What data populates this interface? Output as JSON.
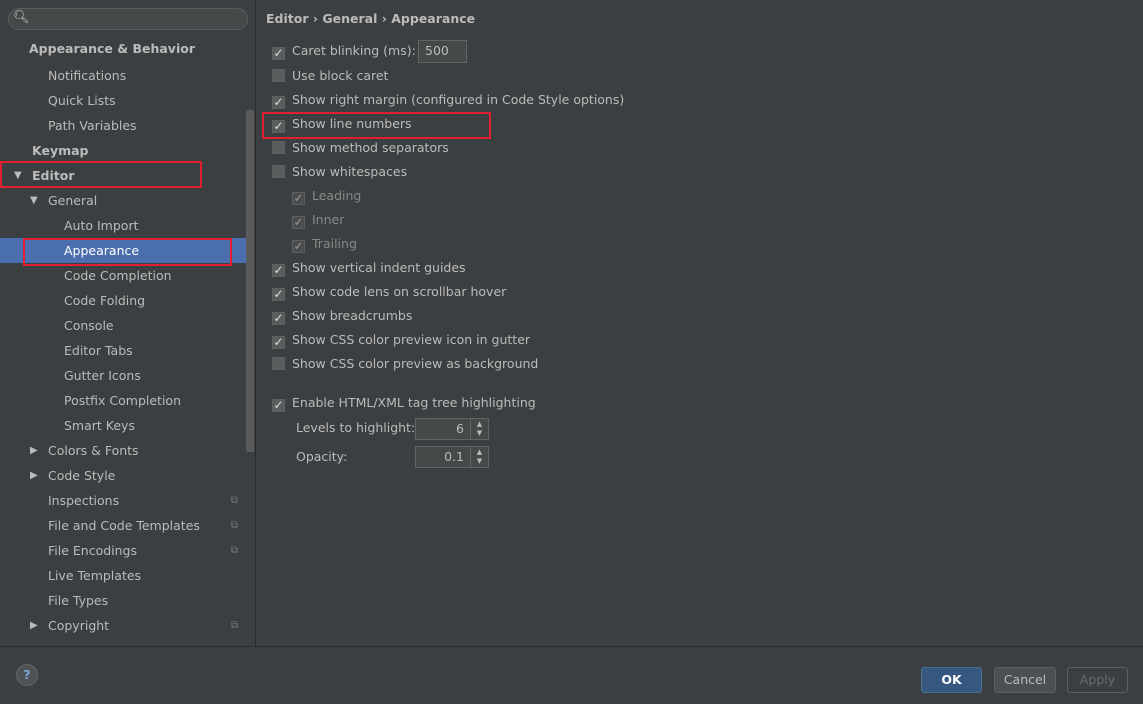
{
  "search": {
    "placeholder": ""
  },
  "sidebar": {
    "items": [
      {
        "label": "Appearance & Behavior"
      },
      {
        "label": "Notifications"
      },
      {
        "label": "Quick Lists"
      },
      {
        "label": "Path Variables"
      },
      {
        "label": "Keymap"
      },
      {
        "label": "Editor"
      },
      {
        "label": "General"
      },
      {
        "label": "Auto Import"
      },
      {
        "label": "Appearance"
      },
      {
        "label": "Code Completion"
      },
      {
        "label": "Code Folding"
      },
      {
        "label": "Console"
      },
      {
        "label": "Editor Tabs"
      },
      {
        "label": "Gutter Icons"
      },
      {
        "label": "Postfix Completion"
      },
      {
        "label": "Smart Keys"
      },
      {
        "label": "Colors & Fonts"
      },
      {
        "label": "Code Style"
      },
      {
        "label": "Inspections"
      },
      {
        "label": "File and Code Templates"
      },
      {
        "label": "File Encodings"
      },
      {
        "label": "Live Templates"
      },
      {
        "label": "File Types"
      },
      {
        "label": "Copyright"
      }
    ]
  },
  "breadcrumb": [
    "Editor",
    "General",
    "Appearance"
  ],
  "breadcrumb_sep": "›",
  "options": [
    {
      "label": "Caret blinking (ms):",
      "checked": true,
      "value": "500"
    },
    {
      "label": "Use block caret",
      "checked": false
    },
    {
      "label": "Show right margin (configured in Code Style options)",
      "checked": true
    },
    {
      "label": "Show line numbers",
      "checked": true
    },
    {
      "label": "Show method separators",
      "checked": false
    },
    {
      "label": "Show whitespaces",
      "checked": false
    },
    {
      "label": "Leading",
      "checked": true,
      "disabled": true
    },
    {
      "label": "Inner",
      "checked": true,
      "disabled": true
    },
    {
      "label": "Trailing",
      "checked": true,
      "disabled": true
    },
    {
      "label": "Show vertical indent guides",
      "checked": true
    },
    {
      "label": "Show code lens on scrollbar hover",
      "checked": true
    },
    {
      "label": "Show breadcrumbs",
      "checked": true
    },
    {
      "label": "Show CSS color preview icon in gutter",
      "checked": true
    },
    {
      "label": "Show CSS color preview as background",
      "checked": false
    },
    {
      "label": "Enable HTML/XML tag tree highlighting",
      "checked": true
    }
  ],
  "levels": {
    "label": "Levels to highlight:",
    "value": "6"
  },
  "opacity": {
    "label": "Opacity:",
    "value": "0.1"
  },
  "buttons": {
    "ok": "OK",
    "cancel": "Cancel",
    "apply": "Apply",
    "help": "?"
  },
  "colors": {
    "background": "#3c3f41",
    "selection": "#4b6eaf",
    "highlight_box": "#e0202e"
  }
}
